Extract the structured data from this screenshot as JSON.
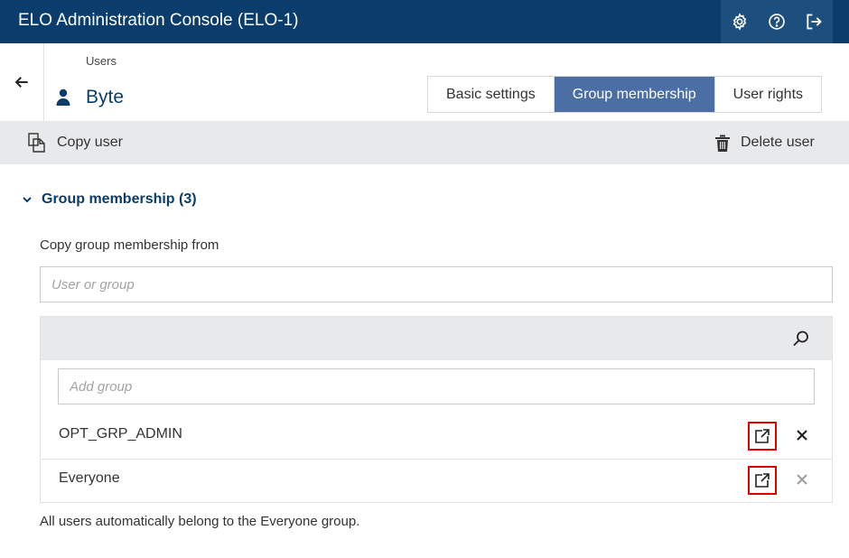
{
  "app": {
    "title": "ELO Administration Console (ELO-1)",
    "icons": [
      "gear-icon",
      "help-icon",
      "logout-icon"
    ],
    "brand_color": "#0a3d6b"
  },
  "header": {
    "breadcrumb": "Users",
    "user_name": "Byte",
    "tabs": [
      {
        "label": "Basic settings",
        "active": false
      },
      {
        "label": "Group membership",
        "active": true
      },
      {
        "label": "User rights",
        "active": false
      }
    ]
  },
  "toolbar": {
    "copy_label": "Copy user",
    "delete_label": "Delete user"
  },
  "section": {
    "title": "Group membership (3)",
    "expanded": true,
    "copy_from_label": "Copy group membership from",
    "copy_from_placeholder": "User or group",
    "add_group_placeholder": "Add group",
    "groups": [
      {
        "name": "OPT_GRP_ADMIN",
        "removable": true
      },
      {
        "name": "Everyone",
        "removable": false
      }
    ],
    "note": "All users automatically belong to the Everyone group."
  },
  "colors": {
    "active_tab": "#4b6fa4",
    "highlight": "#e10000",
    "toolbar_bg": "#e8e9ea"
  }
}
